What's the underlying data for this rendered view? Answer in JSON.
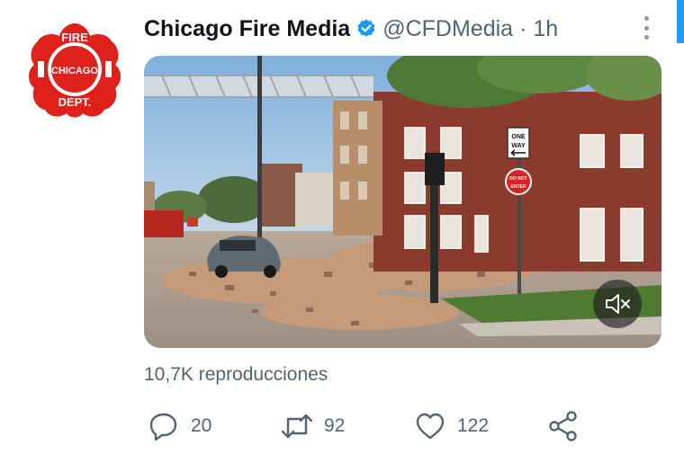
{
  "user": {
    "name": "Chicago Fire Media",
    "handle": "@CFDMedia",
    "separator": "·",
    "time": "1h",
    "avatar_text": {
      "top": "FIRE",
      "middle": "CHICAGO",
      "bottom": "DEPT."
    }
  },
  "views": "10,7K reproducciones",
  "actions": {
    "reply_count": "20",
    "retweet_count": "92",
    "like_count": "122"
  },
  "media": {
    "signs": {
      "one_way_top": "ONE",
      "one_way_bottom": "WAY",
      "do_not_enter_top": "DO NOT",
      "do_not_enter_bottom": "ENTER"
    }
  },
  "icons": {
    "verified": "verified-badge-icon",
    "more": "more-options-icon",
    "mute": "muted-speaker-icon",
    "reply": "reply-icon",
    "retweet": "retweet-icon",
    "like": "heart-icon",
    "share": "share-icon"
  },
  "colors": {
    "accent": "#1d9bf0",
    "brand_red": "#e0201b",
    "text_primary": "#0f1419",
    "text_secondary": "#536471"
  }
}
